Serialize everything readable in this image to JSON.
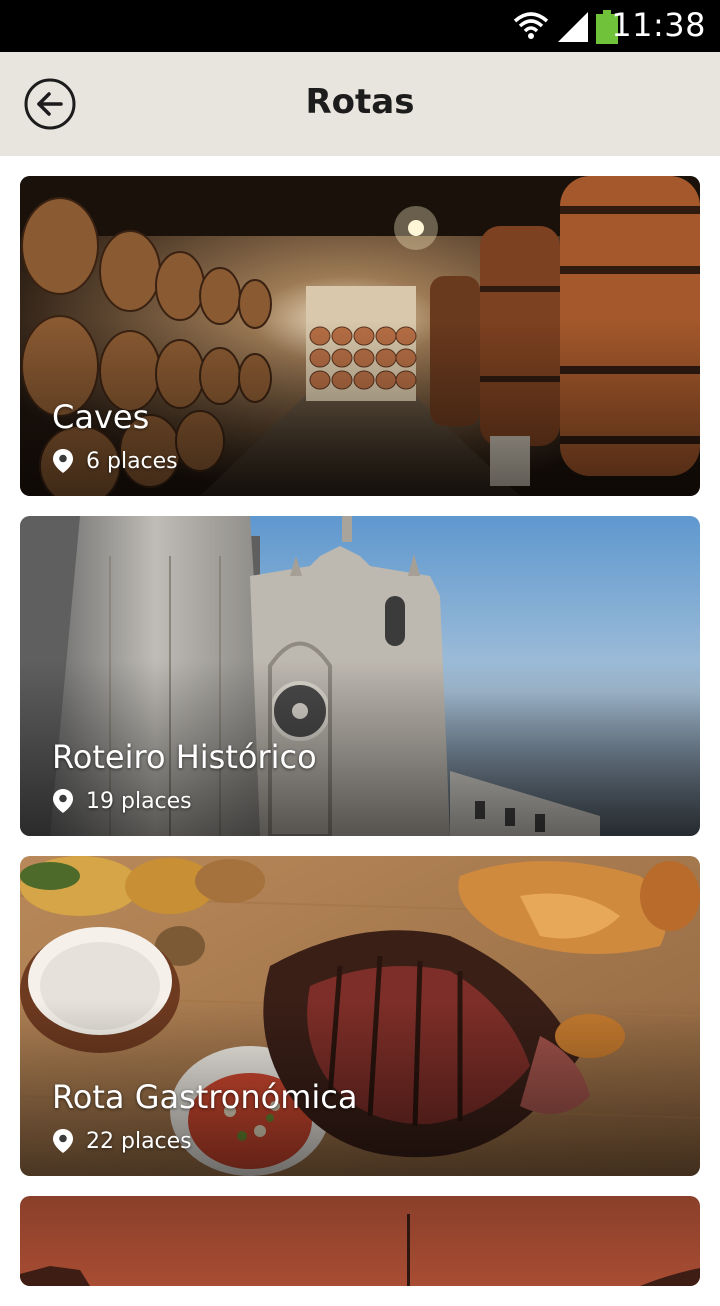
{
  "status_bar": {
    "time": "11:38"
  },
  "app_bar": {
    "title": "Rotas"
  },
  "routes": [
    {
      "name": "Caves",
      "places": "6 places"
    },
    {
      "name": "Roteiro Histórico",
      "places": "19 places"
    },
    {
      "name": "Rota Gastronómica",
      "places": "22 places"
    }
  ],
  "icons": {
    "back": "back-arrow-icon",
    "pin": "location-pin-icon",
    "wifi": "wifi-icon",
    "signal": "signal-icon",
    "battery": "battery-icon"
  },
  "colors": {
    "app_bar": "#e8e4de",
    "status_bar": "#000000",
    "battery": "#6fc23a"
  }
}
